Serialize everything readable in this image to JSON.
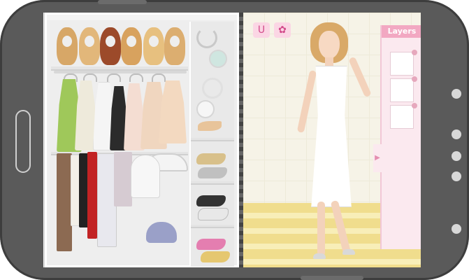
{
  "game": {
    "layers_panel": {
      "title": "Layers"
    },
    "toolbar": {
      "buttons": [
        {
          "icon": "horseshoe-magnet-icon",
          "glyph": "ᑌ"
        },
        {
          "icon": "shoe-icon",
          "glyph": "✿"
        }
      ]
    },
    "layers": [
      {
        "icon": "dress-thumbnail-icon"
      },
      {
        "icon": "outfit-thumbnail-icon"
      },
      {
        "icon": "hair-thumbnail-icon"
      }
    ]
  },
  "colors": {
    "phone_body": "#5a5a5a",
    "layers_accent": "#f2a8c2",
    "floor_stripe": "#f0dd8d"
  }
}
